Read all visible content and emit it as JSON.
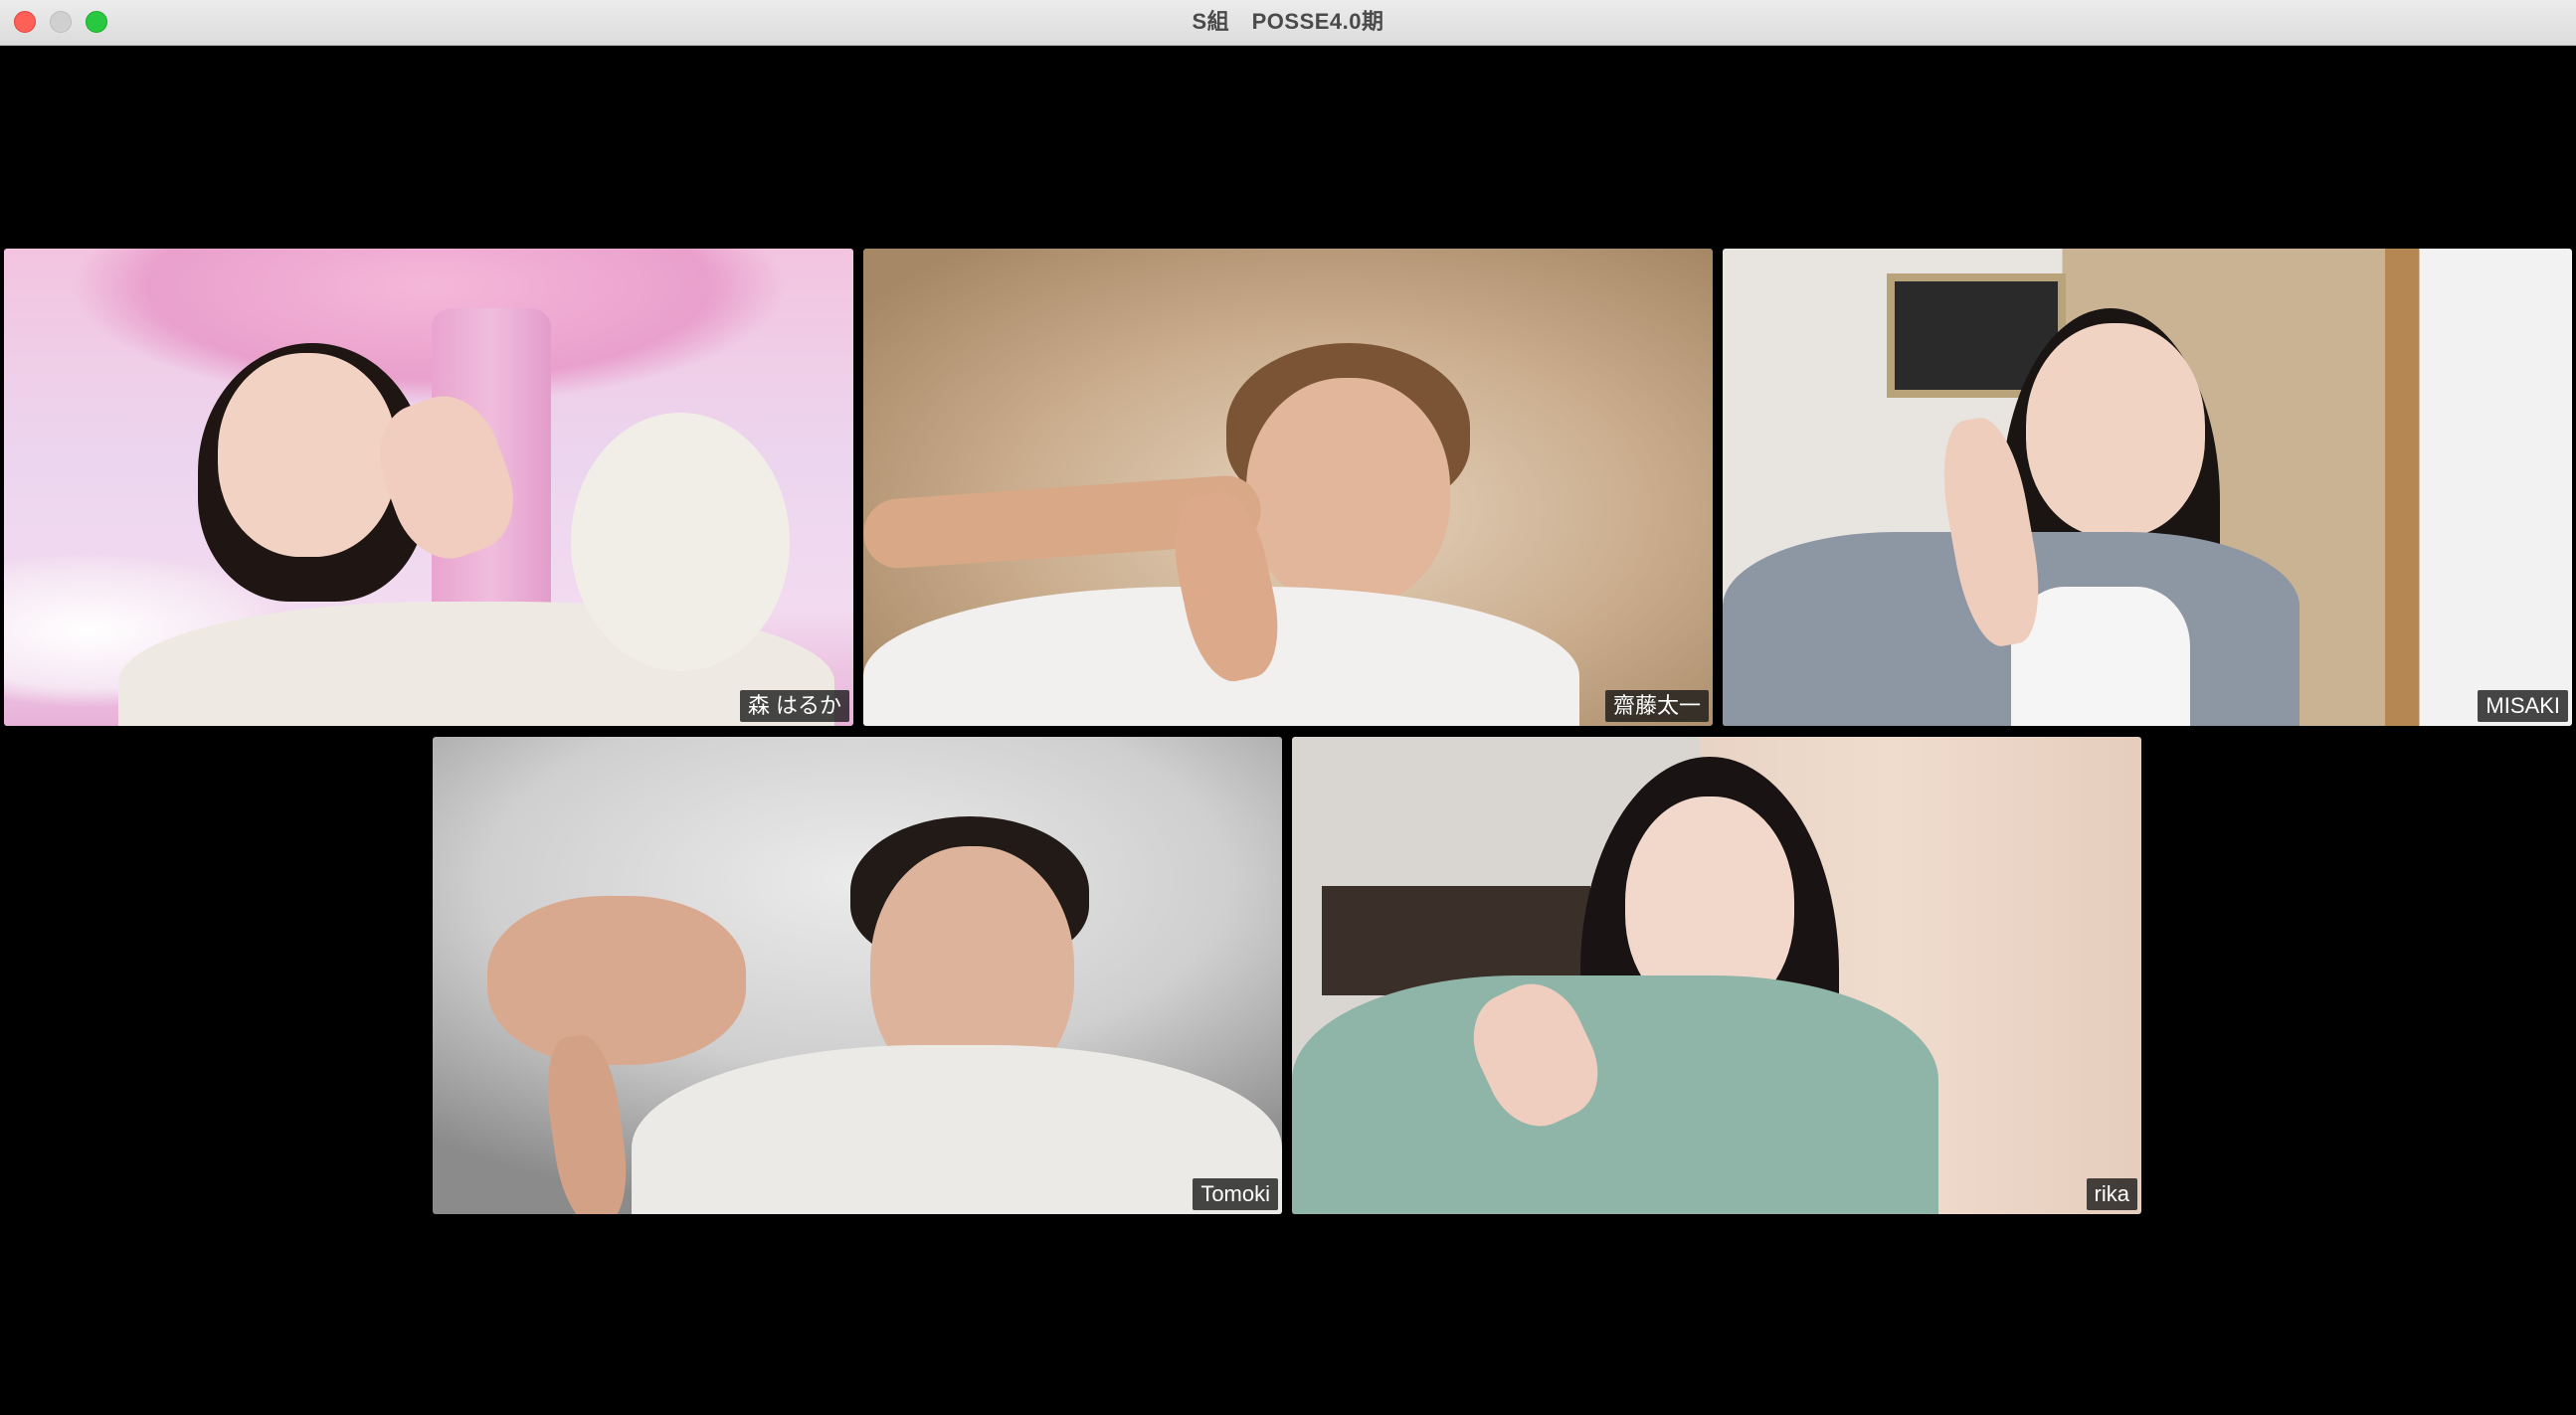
{
  "window": {
    "title": "S組　POSSE4.0期"
  },
  "participants": [
    {
      "name": "森 はるか"
    },
    {
      "name": "齋藤太一"
    },
    {
      "name": "MISAKI"
    },
    {
      "name": "Tomoki"
    },
    {
      "name": "rika"
    }
  ]
}
